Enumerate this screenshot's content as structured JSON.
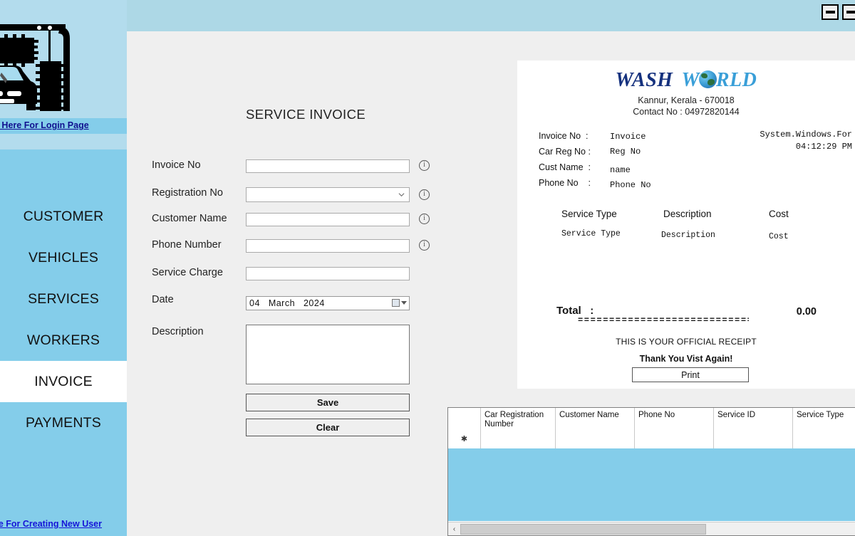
{
  "window": {
    "minimize_label": "–",
    "restore_label": "❐"
  },
  "sidebar": {
    "logo_alt": "car-wash-logo",
    "login_link": "k Here For Login Page",
    "new_user_link": "ere For Creating New User",
    "items": [
      {
        "label": "CUSTOMER",
        "active": false
      },
      {
        "label": "VEHICLES",
        "active": false
      },
      {
        "label": "SERVICES",
        "active": false
      },
      {
        "label": "WORKERS",
        "active": false
      },
      {
        "label": "INVOICE",
        "active": true
      },
      {
        "label": "PAYMENTS",
        "active": false
      }
    ]
  },
  "form": {
    "title": "SERVICE INVOICE",
    "fields": [
      {
        "label": "Invoice No",
        "value": "",
        "type": "text",
        "has_error_icon": true
      },
      {
        "label": "Registration No",
        "value": "",
        "type": "select",
        "has_error_icon": true
      },
      {
        "label": "Customer Name",
        "value": "",
        "type": "text",
        "has_error_icon": true
      },
      {
        "label": "Phone Number",
        "value": "",
        "type": "text",
        "has_error_icon": true
      },
      {
        "label": "Service Charge",
        "value": "",
        "type": "text",
        "has_error_icon": false
      }
    ],
    "date_label": "Date",
    "date_value": "04   March   2024",
    "description_label": "Description",
    "description_value": "",
    "save_label": "Save",
    "clear_label": "Clear"
  },
  "receipt": {
    "brand_part1": "WASH",
    "brand_part2": "W",
    "brand_part3": "RLD",
    "address": "Kannur, Kerala - 670018",
    "contact": "Contact No : 04972820144",
    "meta_left": [
      {
        "label": "Invoice No  :",
        "value": "Invoice"
      },
      {
        "label": "Car Reg No :",
        "value": "Reg No"
      },
      {
        "label": "Cust Name  :",
        "value": "name"
      },
      {
        "label": "Phone No    :",
        "value": "Phone No"
      }
    ],
    "meta_right_line1": "System.Windows.For",
    "meta_right_line2": "04:12:29 PM",
    "table_headers": [
      "Service Type",
      "Description",
      "Cost"
    ],
    "table_rows": [
      [
        "Service Type",
        "Description",
        "Cost"
      ]
    ],
    "total_label": "Total   :",
    "total_value": "0.00",
    "divider": "================================",
    "official_text": "THIS IS YOUR OFFICIAL RECEIPT",
    "thanks_text": "Thank You Vist Again!",
    "print_label": "Print"
  },
  "grid": {
    "columns": [
      "",
      "Car Registration Number",
      "Customer Name",
      "Phone No",
      "Service ID",
      "Service Type"
    ],
    "new_row_marker": "✱",
    "rows": [
      [
        "",
        "",
        "",
        "",
        "",
        ""
      ]
    ],
    "scroll_left_arrow": "‹"
  },
  "colors": {
    "sidebar_blue": "#84cdea",
    "header_blue": "#add8e6",
    "light_blue": "#b3dced",
    "panel_gray": "#efefef",
    "active_nav": "#ffffff",
    "brand_dark": "#15317e",
    "brand_light": "#3a9fd8",
    "link_blue": "#1515d8"
  }
}
